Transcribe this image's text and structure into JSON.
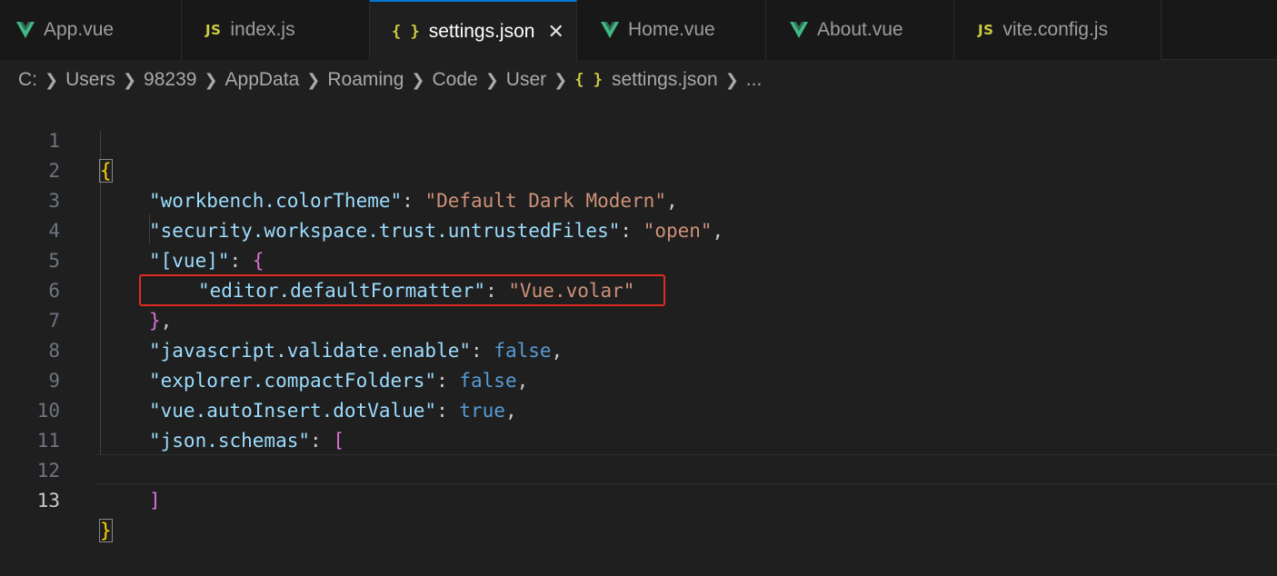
{
  "tabs": [
    {
      "label": "App.vue",
      "icon": "vue-icon"
    },
    {
      "label": "index.js",
      "icon": "js-icon",
      "badge": "JS"
    },
    {
      "label": "settings.json",
      "icon": "json-icon",
      "badge": "{ }",
      "active": true,
      "close": "✕"
    },
    {
      "label": "Home.vue",
      "icon": "vue-icon"
    },
    {
      "label": "About.vue",
      "icon": "vue-icon"
    },
    {
      "label": "vite.config.js",
      "icon": "js-icon",
      "badge": "JS"
    }
  ],
  "breadcrumb": {
    "items": [
      "C:",
      "Users",
      "98239",
      "AppData",
      "Roaming",
      "Code",
      "User"
    ],
    "file_icon": "{ }",
    "file": "settings.json",
    "ellipsis": "..."
  },
  "editor": {
    "active_line": 13,
    "lines": [
      {
        "n": "1"
      },
      {
        "n": "2"
      },
      {
        "n": "3"
      },
      {
        "n": "4"
      },
      {
        "n": "5"
      },
      {
        "n": "6"
      },
      {
        "n": "7"
      },
      {
        "n": "8"
      },
      {
        "n": "9"
      },
      {
        "n": "10"
      },
      {
        "n": "11"
      },
      {
        "n": "12"
      },
      {
        "n": "13"
      }
    ],
    "tokens": {
      "open_brace": "{",
      "close_brace": "}",
      "l2_key": "\"workbench.colorTheme\"",
      "l2_val": "\"Default Dark Modern\"",
      "l3_key": "\"security.workspace.trust.untrustedFiles\"",
      "l3_val": "\"open\"",
      "l4_key": "\"[vue]\"",
      "l4_open": "{",
      "l5_key": "\"editor.defaultFormatter\"",
      "l5_val": "\"Vue.volar\"",
      "l6_close": "}",
      "l7_key": "\"javascript.validate.enable\"",
      "l7_val": "false",
      "l8_key": "\"explorer.compactFolders\"",
      "l8_val": "false",
      "l9_key": "\"vue.autoInsert.dotValue\"",
      "l9_val": "true",
      "l10_key": "\"json.schemas\"",
      "l10_open": "[",
      "l12_close": "]",
      "colon": ": ",
      "comma": ","
    }
  },
  "colors": {
    "highlight_border": "#e02b20",
    "active_tab_accent": "#0078d4"
  }
}
